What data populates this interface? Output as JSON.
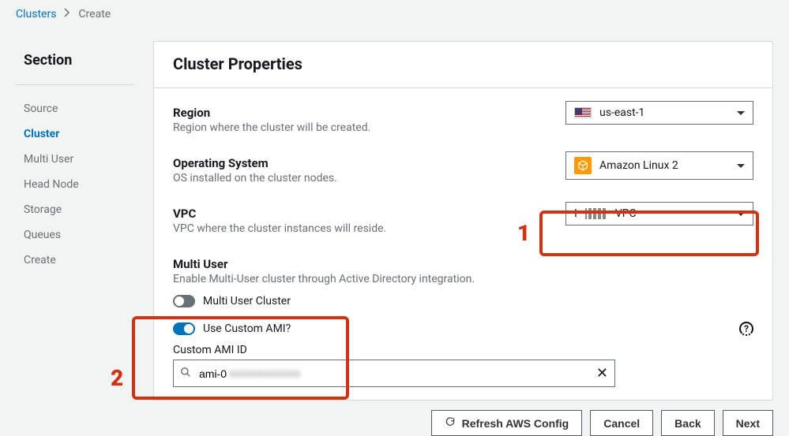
{
  "breadcrumb": {
    "root": "Clusters",
    "current": "Create"
  },
  "sidebar": {
    "title": "Section",
    "items": [
      {
        "label": "Source"
      },
      {
        "label": "Cluster",
        "active": true
      },
      {
        "label": "Multi User"
      },
      {
        "label": "Head Node"
      },
      {
        "label": "Storage"
      },
      {
        "label": "Queues"
      },
      {
        "label": "Create"
      }
    ]
  },
  "panel": {
    "title": "Cluster Properties",
    "region": {
      "label": "Region",
      "desc": "Region where the cluster will be created.",
      "value": "us-east-1",
      "icon": "flag-us"
    },
    "os": {
      "label": "Operating System",
      "desc": "OS installed on the cluster nodes.",
      "value": "Amazon Linux 2",
      "icon": "box-icon"
    },
    "vpc": {
      "label": "VPC",
      "desc": "VPC where the cluster instances will reside.",
      "prefix": "I",
      "suffix": "VPC"
    },
    "multiuser": {
      "label": "Multi User",
      "desc": "Enable Multi-User cluster through Active Directory integration.",
      "toggle_label": "Multi User Cluster",
      "enabled": false
    },
    "custom_ami": {
      "toggle_label": "Use Custom AMI?",
      "enabled": true,
      "id_label": "Custom AMI ID",
      "value_prefix": "ami-0",
      "value_obscured": "xxxxxxxxxxxxx"
    }
  },
  "footer": {
    "refresh": "Refresh AWS Config",
    "cancel": "Cancel",
    "back": "Back",
    "next": "Next"
  },
  "annotations": {
    "one": "1",
    "two": "2"
  }
}
